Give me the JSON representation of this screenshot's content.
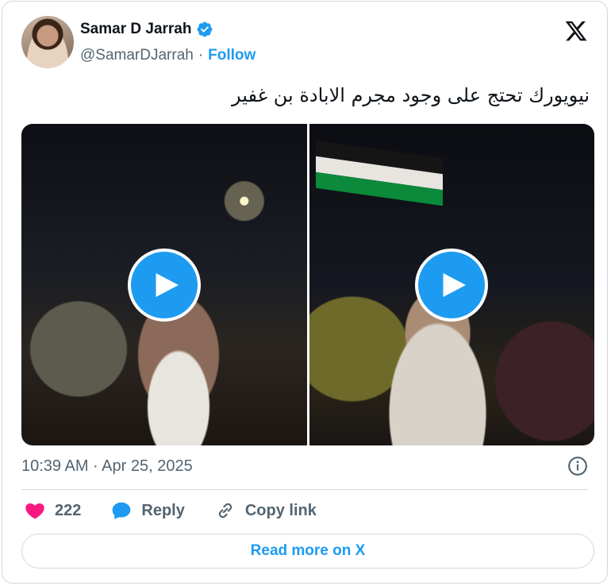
{
  "author": {
    "name": "Samar D Jarrah",
    "handle": "@SamarDJarrah",
    "separator": "·",
    "follow_label": "Follow"
  },
  "tweet": {
    "text": "نيويورك تحتج على وجود مجرم الابادة بن غفير"
  },
  "meta": {
    "timestamp": "10:39 AM · Apr 25, 2025"
  },
  "actions": {
    "likes_count": "222",
    "reply_label": "Reply",
    "copy_link_label": "Copy link"
  },
  "read_more_label": "Read more on X",
  "icons": {
    "verified": "verified-badge-icon",
    "x_logo": "x-logo-icon",
    "play": "play-icon",
    "info": "info-icon",
    "heart": "heart-icon",
    "reply": "reply-bubble-icon",
    "link": "link-icon"
  },
  "colors": {
    "accent": "#1d9bf0",
    "heart": "#f91880",
    "secondary_text": "#536471",
    "primary_text": "#0f1419",
    "border": "#cfd9de"
  }
}
